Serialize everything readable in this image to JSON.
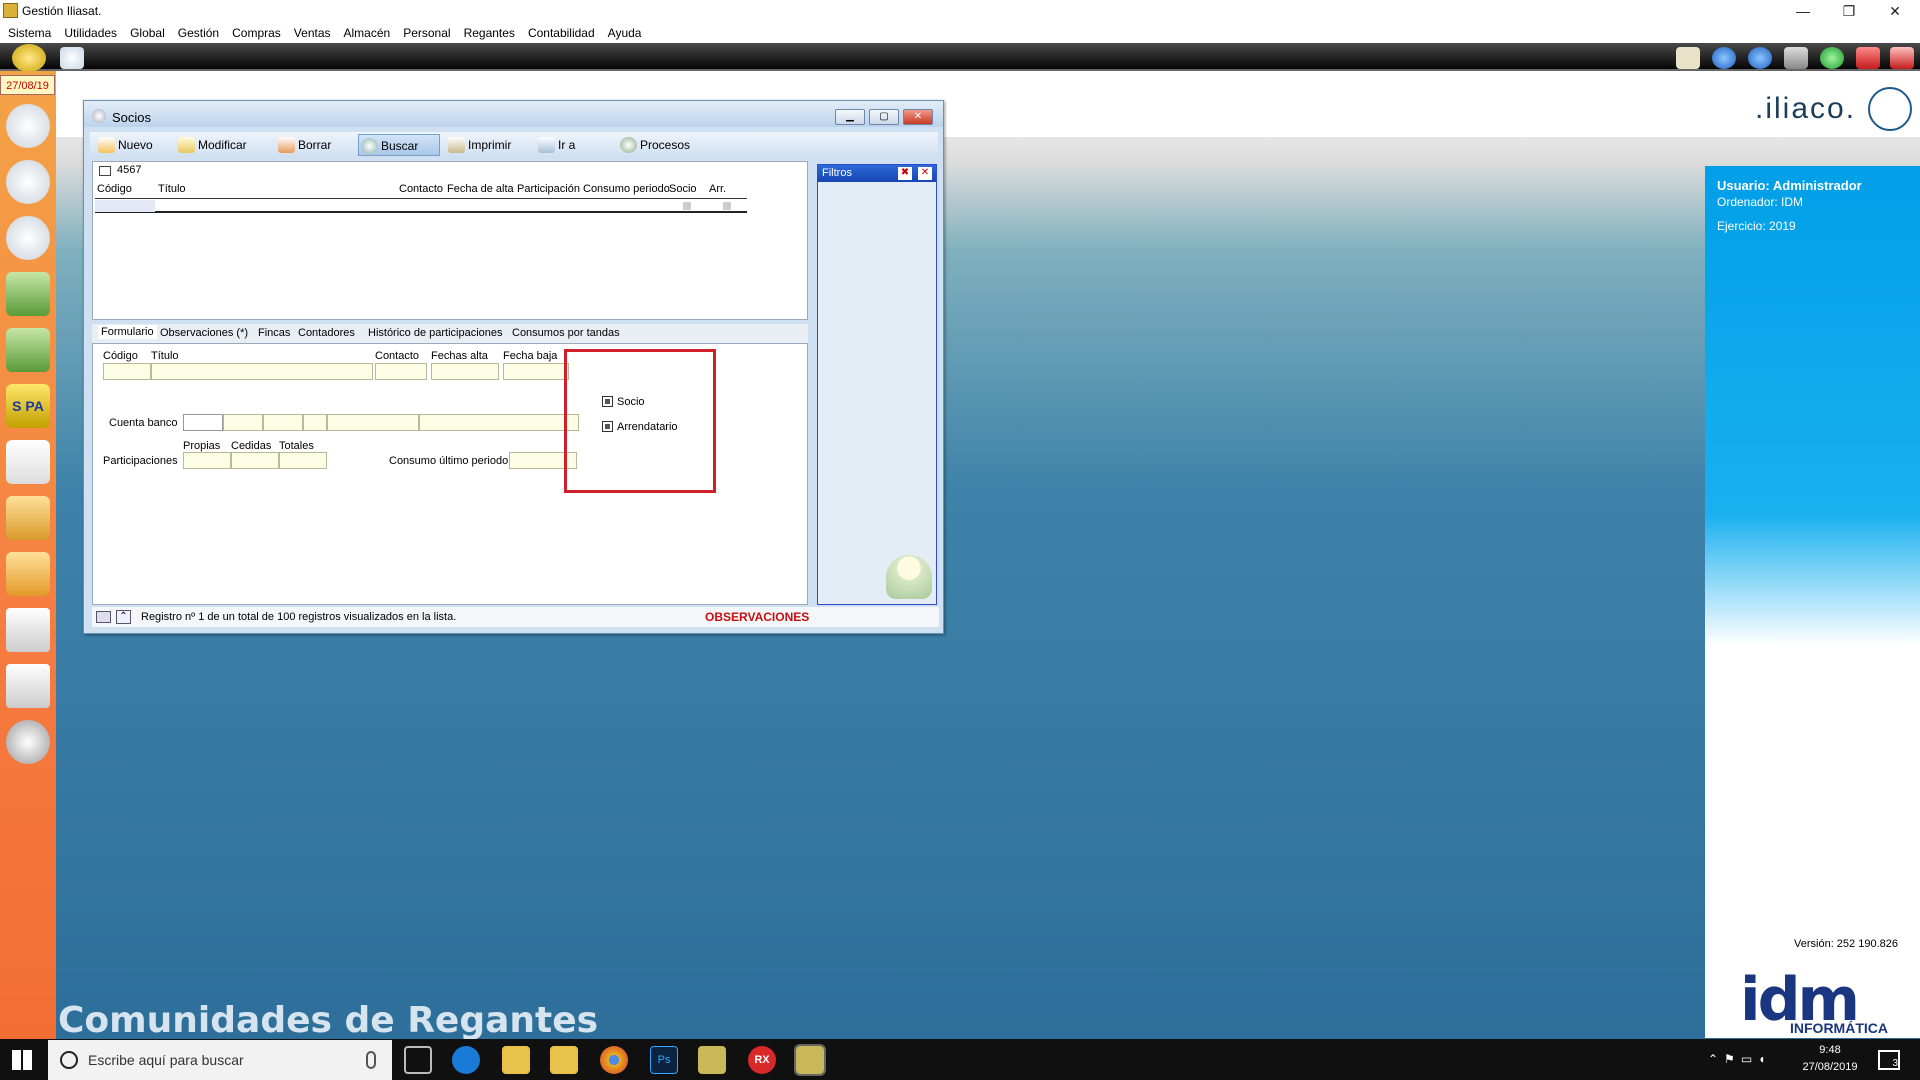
{
  "app": {
    "title": "Gestión Iliasat."
  },
  "menu": [
    "Sistema",
    "Utilidades",
    "Global",
    "Gestión",
    "Compras",
    "Ventas",
    "Almacén",
    "Personal",
    "Regantes",
    "Contabilidad",
    "Ayuda"
  ],
  "date": "27/08/19",
  "brand": ".iliaco.",
  "user_panel": {
    "usuario": "Usuario: Administrador",
    "ordenador": "Ordenador: IDM",
    "ejercicio": "Ejercicio: 2019"
  },
  "version": "Versión: 252 190.826",
  "company": {
    "logo": "idm",
    "sub": "INFORMÁTICA"
  },
  "desktop_title": "Comunidades de Regantes",
  "window": {
    "title": "Socios",
    "toolbar": [
      "Nuevo",
      "Modificar",
      "Borrar",
      "Buscar",
      "Imprimir",
      "Ir a",
      "Procesos"
    ],
    "search_value": "4567",
    "grid_headers": [
      "Código",
      "Título",
      "Contacto",
      "Fecha de alta",
      "Participación",
      "Consumo periodo",
      "Socio",
      "Arr."
    ],
    "tabs": [
      "Formulario",
      "Observaciones (*)",
      "Fincas",
      "Contadores",
      "Histórico de participaciones",
      "Consumos por tandas"
    ],
    "form": {
      "codigo": "Código",
      "titulo": "Título",
      "contacto": "Contacto",
      "fechas_alta": "Fechas alta",
      "fecha_baja": "Fecha baja",
      "cuenta_banco": "Cuenta banco",
      "participaciones": "Participaciones",
      "propias": "Propias",
      "cedidas": "Cedidas",
      "totales": "Totales",
      "consumo": "Consumo último periodo",
      "socio": "Socio",
      "arrendatario": "Arrendatario"
    },
    "filtros": "Filtros",
    "status": "Registro nº 1 de un total de 100 registros visualizados en la lista.",
    "observaciones": "OBSERVACIONES"
  },
  "taskbar": {
    "search_placeholder": "Escribe aquí para buscar",
    "time": "9:48",
    "date": "27/08/2019",
    "notifications": "3"
  },
  "colors": {
    "accent": "#009fe8",
    "desktop": "#2d6f9a",
    "highlight": "#d0202a"
  }
}
